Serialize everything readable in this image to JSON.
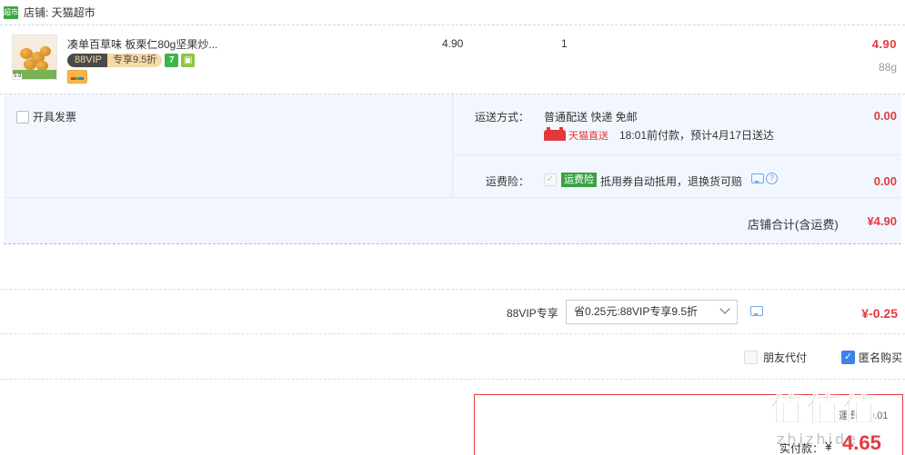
{
  "shop": {
    "logo_text": "超市",
    "name": "店铺: 天猫超市"
  },
  "item": {
    "title": "凑单百草味 板栗仁80g坚果炒...",
    "thumb_price": "5.9",
    "vip_left": "88VIP",
    "vip_right": "专享9.5折",
    "badge_seven": "7",
    "unit_price": "4.90",
    "quantity": "1",
    "subtotal": "4.90",
    "weight": "88g"
  },
  "invoice": {
    "label": "开具发票"
  },
  "shipping": {
    "label": "运送方式：",
    "value": "普通配送 快递 免邮",
    "fee": "0.00",
    "tmall_direct": "天猫直送",
    "delivery": "18:01前付款，预计4月17日送达"
  },
  "insurance": {
    "label": "运费险：",
    "tag": "运费险",
    "desc": "抵用券自动抵用，退换货可赔",
    "fee": "0.00"
  },
  "shop_total": {
    "label": "店铺合计(含运费)",
    "value": "¥4.90"
  },
  "vip_discount": {
    "label": "88VIP专享",
    "select_value": "省0.25元:88VIP专享9.5折",
    "amount": "¥-0.25"
  },
  "options": {
    "friend_pay": "朋友代付",
    "anonymous": "匿名购买"
  },
  "payment": {
    "sub_label": "運費：0.01",
    "label": "实付款：",
    "currency": "¥",
    "amount": "4.65"
  },
  "watermark": {
    "big": "值值值",
    "small": "zhizhide"
  },
  "colors": {
    "price_red": "#e4393c",
    "panel_bg": "#f2f7ff",
    "tag_green": "#3aa043",
    "check_blue": "#3b82e6"
  }
}
